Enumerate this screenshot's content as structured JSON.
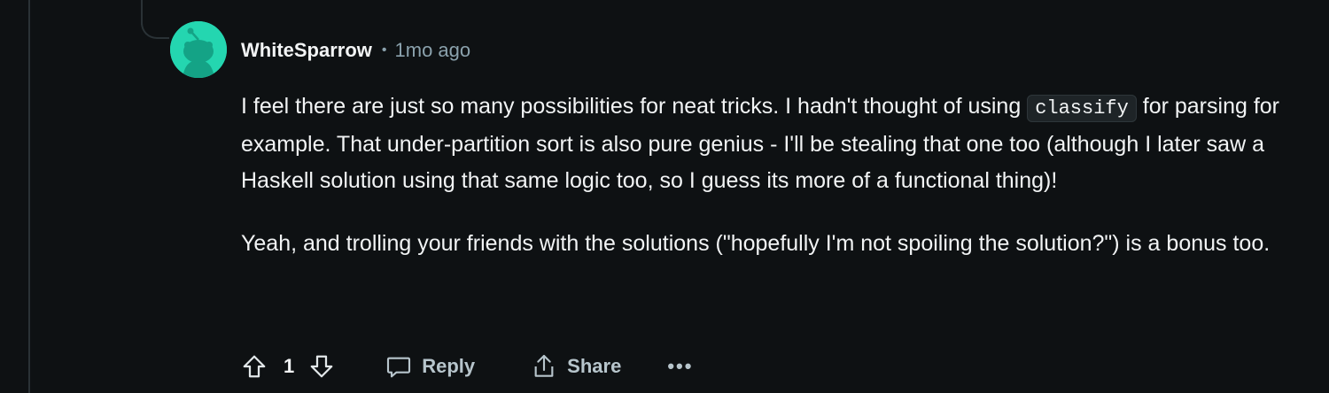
{
  "comment": {
    "username": "WhiteSparrow",
    "separator": "•",
    "time": "1mo ago",
    "paragraph1_before_code": "I feel there are just so many possibilities for neat tricks. I hadn't thought of using ",
    "code": "classify",
    "paragraph1_after_code": " for parsing for example. That under-partition sort is also pure genius - I'll be stealing that one too (although I later saw a Haskell solution using that same logic too, so I guess its more of a functional thing)!",
    "paragraph2": "Yeah, and trolling your friends with the solutions (\"hopefully I'm not spoiling the solution?\") is a bonus too."
  },
  "actions": {
    "score": "1",
    "reply_label": "Reply",
    "share_label": "Share",
    "more_label": "•••"
  },
  "icons": {
    "avatar": "snoo-avatar-icon",
    "upvote": "upvote-arrow-icon",
    "downvote": "downvote-arrow-icon",
    "reply": "speech-bubble-icon",
    "share": "share-arrow-icon"
  },
  "colors": {
    "background": "#0e1113",
    "avatar_bg": "#24d6b0",
    "muted_text": "#8ba2ad"
  }
}
